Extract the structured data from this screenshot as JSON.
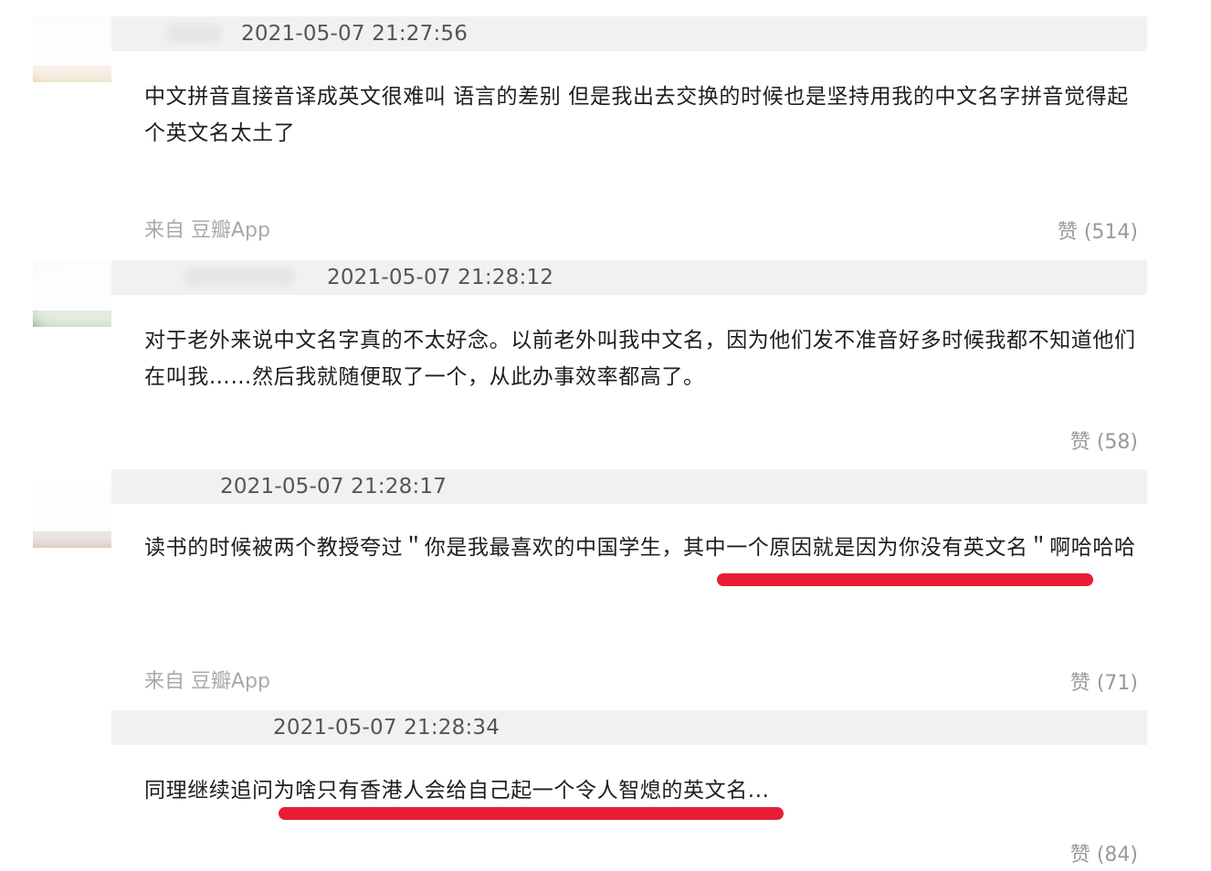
{
  "comments": [
    {
      "timestamp": "2021-05-07 21:27:56",
      "text": "中文拼音直接音译成英文很难叫 语言的差别 但是我出去交换的时候也是坚持用我的中文名字拼音觉得起个英文名太土了",
      "source": "来自 豆瓣App",
      "likes": "赞 (514)"
    },
    {
      "timestamp": "2021-05-07 21:28:12",
      "text": "对于老外来说中文名字真的不太好念。以前老外叫我中文名，因为他们发不准音好多时候我都不知道他们在叫我……然后我就随便取了一个，从此办事效率都高了。",
      "source": "",
      "likes": "赞 (58)"
    },
    {
      "timestamp": "2021-05-07 21:28:17",
      "text": "读书的时候被两个教授夸过＂你是我最喜欢的中国学生，其中一个原因就是因为你没有英文名＂啊哈哈哈",
      "source": "来自 豆瓣App",
      "likes": "赞 (71)"
    },
    {
      "timestamp": "2021-05-07 21:28:34",
      "text": "同理继续追问为啥只有香港人会给自己起一个令人智熄的英文名...",
      "source": "",
      "likes": "赞 (84)"
    }
  ],
  "colors": {
    "highlight": "#e8102a",
    "meta_bar": "#f1f1f1",
    "muted": "#999999"
  }
}
